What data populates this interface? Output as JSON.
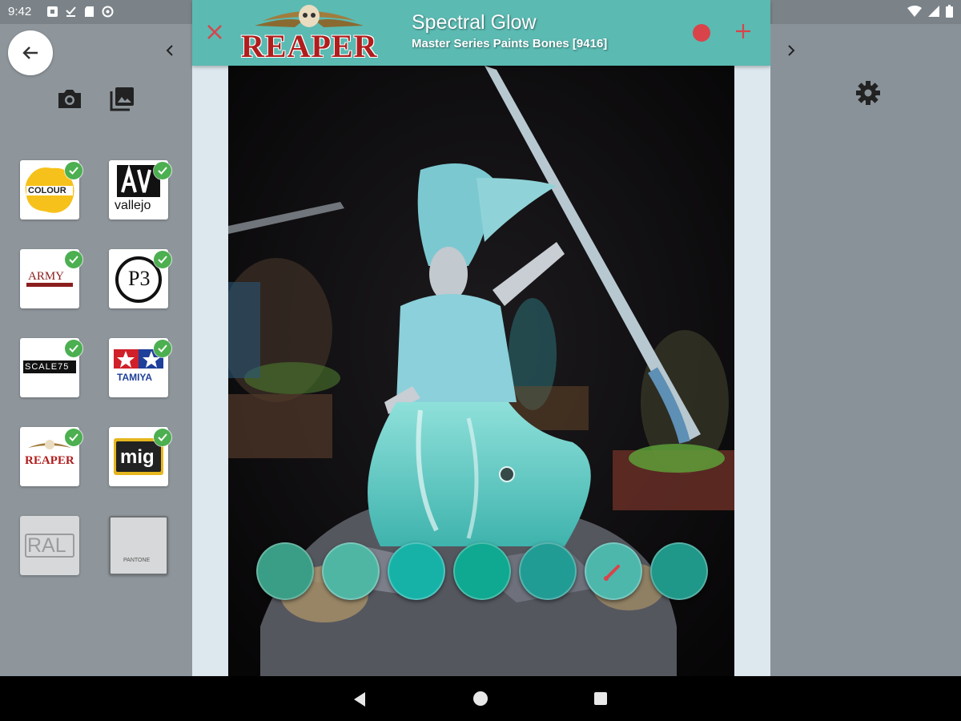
{
  "status_bar": {
    "time": "9:42"
  },
  "left_panel": {
    "brands": [
      {
        "name": "Citadel Colour",
        "logo_text": "COLOUR",
        "checked": true
      },
      {
        "name": "Vallejo",
        "logo_text": "vallejo",
        "checked": true
      },
      {
        "name": "Army Painter",
        "logo_text": "ARMY",
        "checked": true
      },
      {
        "name": "P3 Formula",
        "logo_text": "P3",
        "checked": true
      },
      {
        "name": "Scale75",
        "logo_text": "SCALE75",
        "checked": true
      },
      {
        "name": "Tamiya",
        "logo_text": "TAMIYA",
        "checked": true
      },
      {
        "name": "Reaper",
        "logo_text": "REAPER",
        "checked": true
      },
      {
        "name": "MIG",
        "logo_text": "mig",
        "checked": true
      },
      {
        "name": "RAL",
        "logo_text": "RAL",
        "checked": false
      },
      {
        "name": "Pantone",
        "logo_text": "PANTONE",
        "checked": false
      }
    ]
  },
  "header": {
    "brand_logo": "REAPER",
    "paint_name": "Spectral Glow",
    "paint_subtitle": "Master Series Paints Bones [9416]"
  },
  "swatches": [
    "#3a9e86",
    "#4fb6a4",
    "#16b2a8",
    "#0fa890",
    "#209c94",
    "#4db7ac",
    "#1f9789"
  ],
  "colors": {
    "header_bg": "#5bbab2",
    "accent_red": "#d9444a",
    "check_green": "#4caf50"
  },
  "icons": {
    "back": "arrow-left-icon",
    "camera": "camera-icon",
    "gallery": "gallery-icon",
    "settings": "gear-icon",
    "edit": "brush-icon"
  }
}
